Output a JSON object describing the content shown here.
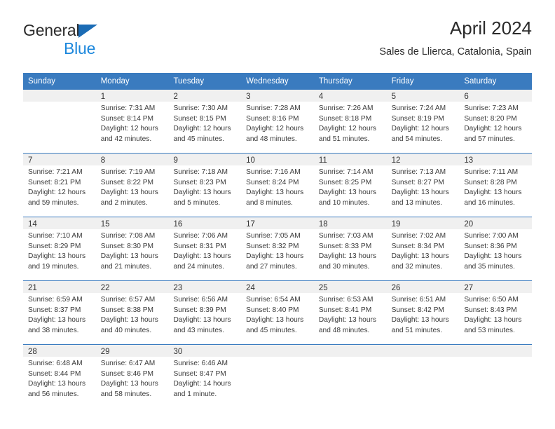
{
  "logo": {
    "word_one": "General",
    "word_two": "Blue",
    "triangle_color": "#1b6cb5",
    "blue_color": "#1b87dc"
  },
  "header": {
    "title": "April 2024",
    "subtitle": "Sales de Llierca, Catalonia, Spain"
  },
  "theme": {
    "header_blue": "#3a7bbf",
    "date_band_gray": "#f0f0f0",
    "text_color": "#3a3a3a"
  },
  "calendar": {
    "day_headers": [
      "Sunday",
      "Monday",
      "Tuesday",
      "Wednesday",
      "Thursday",
      "Friday",
      "Saturday"
    ],
    "weeks": [
      [
        {
          "date": "",
          "sunrise": "",
          "sunset": "",
          "daylight": "",
          "empty": true
        },
        {
          "date": "1",
          "sunrise": "Sunrise: 7:31 AM",
          "sunset": "Sunset: 8:14 PM",
          "daylight": "Daylight: 12 hours and 42 minutes."
        },
        {
          "date": "2",
          "sunrise": "Sunrise: 7:30 AM",
          "sunset": "Sunset: 8:15 PM",
          "daylight": "Daylight: 12 hours and 45 minutes."
        },
        {
          "date": "3",
          "sunrise": "Sunrise: 7:28 AM",
          "sunset": "Sunset: 8:16 PM",
          "daylight": "Daylight: 12 hours and 48 minutes."
        },
        {
          "date": "4",
          "sunrise": "Sunrise: 7:26 AM",
          "sunset": "Sunset: 8:18 PM",
          "daylight": "Daylight: 12 hours and 51 minutes."
        },
        {
          "date": "5",
          "sunrise": "Sunrise: 7:24 AM",
          "sunset": "Sunset: 8:19 PM",
          "daylight": "Daylight: 12 hours and 54 minutes."
        },
        {
          "date": "6",
          "sunrise": "Sunrise: 7:23 AM",
          "sunset": "Sunset: 8:20 PM",
          "daylight": "Daylight: 12 hours and 57 minutes."
        }
      ],
      [
        {
          "date": "7",
          "sunrise": "Sunrise: 7:21 AM",
          "sunset": "Sunset: 8:21 PM",
          "daylight": "Daylight: 12 hours and 59 minutes."
        },
        {
          "date": "8",
          "sunrise": "Sunrise: 7:19 AM",
          "sunset": "Sunset: 8:22 PM",
          "daylight": "Daylight: 13 hours and 2 minutes."
        },
        {
          "date": "9",
          "sunrise": "Sunrise: 7:18 AM",
          "sunset": "Sunset: 8:23 PM",
          "daylight": "Daylight: 13 hours and 5 minutes."
        },
        {
          "date": "10",
          "sunrise": "Sunrise: 7:16 AM",
          "sunset": "Sunset: 8:24 PM",
          "daylight": "Daylight: 13 hours and 8 minutes."
        },
        {
          "date": "11",
          "sunrise": "Sunrise: 7:14 AM",
          "sunset": "Sunset: 8:25 PM",
          "daylight": "Daylight: 13 hours and 10 minutes."
        },
        {
          "date": "12",
          "sunrise": "Sunrise: 7:13 AM",
          "sunset": "Sunset: 8:27 PM",
          "daylight": "Daylight: 13 hours and 13 minutes."
        },
        {
          "date": "13",
          "sunrise": "Sunrise: 7:11 AM",
          "sunset": "Sunset: 8:28 PM",
          "daylight": "Daylight: 13 hours and 16 minutes."
        }
      ],
      [
        {
          "date": "14",
          "sunrise": "Sunrise: 7:10 AM",
          "sunset": "Sunset: 8:29 PM",
          "daylight": "Daylight: 13 hours and 19 minutes."
        },
        {
          "date": "15",
          "sunrise": "Sunrise: 7:08 AM",
          "sunset": "Sunset: 8:30 PM",
          "daylight": "Daylight: 13 hours and 21 minutes."
        },
        {
          "date": "16",
          "sunrise": "Sunrise: 7:06 AM",
          "sunset": "Sunset: 8:31 PM",
          "daylight": "Daylight: 13 hours and 24 minutes."
        },
        {
          "date": "17",
          "sunrise": "Sunrise: 7:05 AM",
          "sunset": "Sunset: 8:32 PM",
          "daylight": "Daylight: 13 hours and 27 minutes."
        },
        {
          "date": "18",
          "sunrise": "Sunrise: 7:03 AM",
          "sunset": "Sunset: 8:33 PM",
          "daylight": "Daylight: 13 hours and 30 minutes."
        },
        {
          "date": "19",
          "sunrise": "Sunrise: 7:02 AM",
          "sunset": "Sunset: 8:34 PM",
          "daylight": "Daylight: 13 hours and 32 minutes."
        },
        {
          "date": "20",
          "sunrise": "Sunrise: 7:00 AM",
          "sunset": "Sunset: 8:36 PM",
          "daylight": "Daylight: 13 hours and 35 minutes."
        }
      ],
      [
        {
          "date": "21",
          "sunrise": "Sunrise: 6:59 AM",
          "sunset": "Sunset: 8:37 PM",
          "daylight": "Daylight: 13 hours and 38 minutes."
        },
        {
          "date": "22",
          "sunrise": "Sunrise: 6:57 AM",
          "sunset": "Sunset: 8:38 PM",
          "daylight": "Daylight: 13 hours and 40 minutes."
        },
        {
          "date": "23",
          "sunrise": "Sunrise: 6:56 AM",
          "sunset": "Sunset: 8:39 PM",
          "daylight": "Daylight: 13 hours and 43 minutes."
        },
        {
          "date": "24",
          "sunrise": "Sunrise: 6:54 AM",
          "sunset": "Sunset: 8:40 PM",
          "daylight": "Daylight: 13 hours and 45 minutes."
        },
        {
          "date": "25",
          "sunrise": "Sunrise: 6:53 AM",
          "sunset": "Sunset: 8:41 PM",
          "daylight": "Daylight: 13 hours and 48 minutes."
        },
        {
          "date": "26",
          "sunrise": "Sunrise: 6:51 AM",
          "sunset": "Sunset: 8:42 PM",
          "daylight": "Daylight: 13 hours and 51 minutes."
        },
        {
          "date": "27",
          "sunrise": "Sunrise: 6:50 AM",
          "sunset": "Sunset: 8:43 PM",
          "daylight": "Daylight: 13 hours and 53 minutes."
        }
      ],
      [
        {
          "date": "28",
          "sunrise": "Sunrise: 6:48 AM",
          "sunset": "Sunset: 8:44 PM",
          "daylight": "Daylight: 13 hours and 56 minutes."
        },
        {
          "date": "29",
          "sunrise": "Sunrise: 6:47 AM",
          "sunset": "Sunset: 8:46 PM",
          "daylight": "Daylight: 13 hours and 58 minutes."
        },
        {
          "date": "30",
          "sunrise": "Sunrise: 6:46 AM",
          "sunset": "Sunset: 8:47 PM",
          "daylight": "Daylight: 14 hours and 1 minute."
        },
        {
          "date": "",
          "sunrise": "",
          "sunset": "",
          "daylight": "",
          "empty": true
        },
        {
          "date": "",
          "sunrise": "",
          "sunset": "",
          "daylight": "",
          "empty": true
        },
        {
          "date": "",
          "sunrise": "",
          "sunset": "",
          "daylight": "",
          "empty": true
        },
        {
          "date": "",
          "sunrise": "",
          "sunset": "",
          "daylight": "",
          "empty": true
        }
      ]
    ]
  }
}
